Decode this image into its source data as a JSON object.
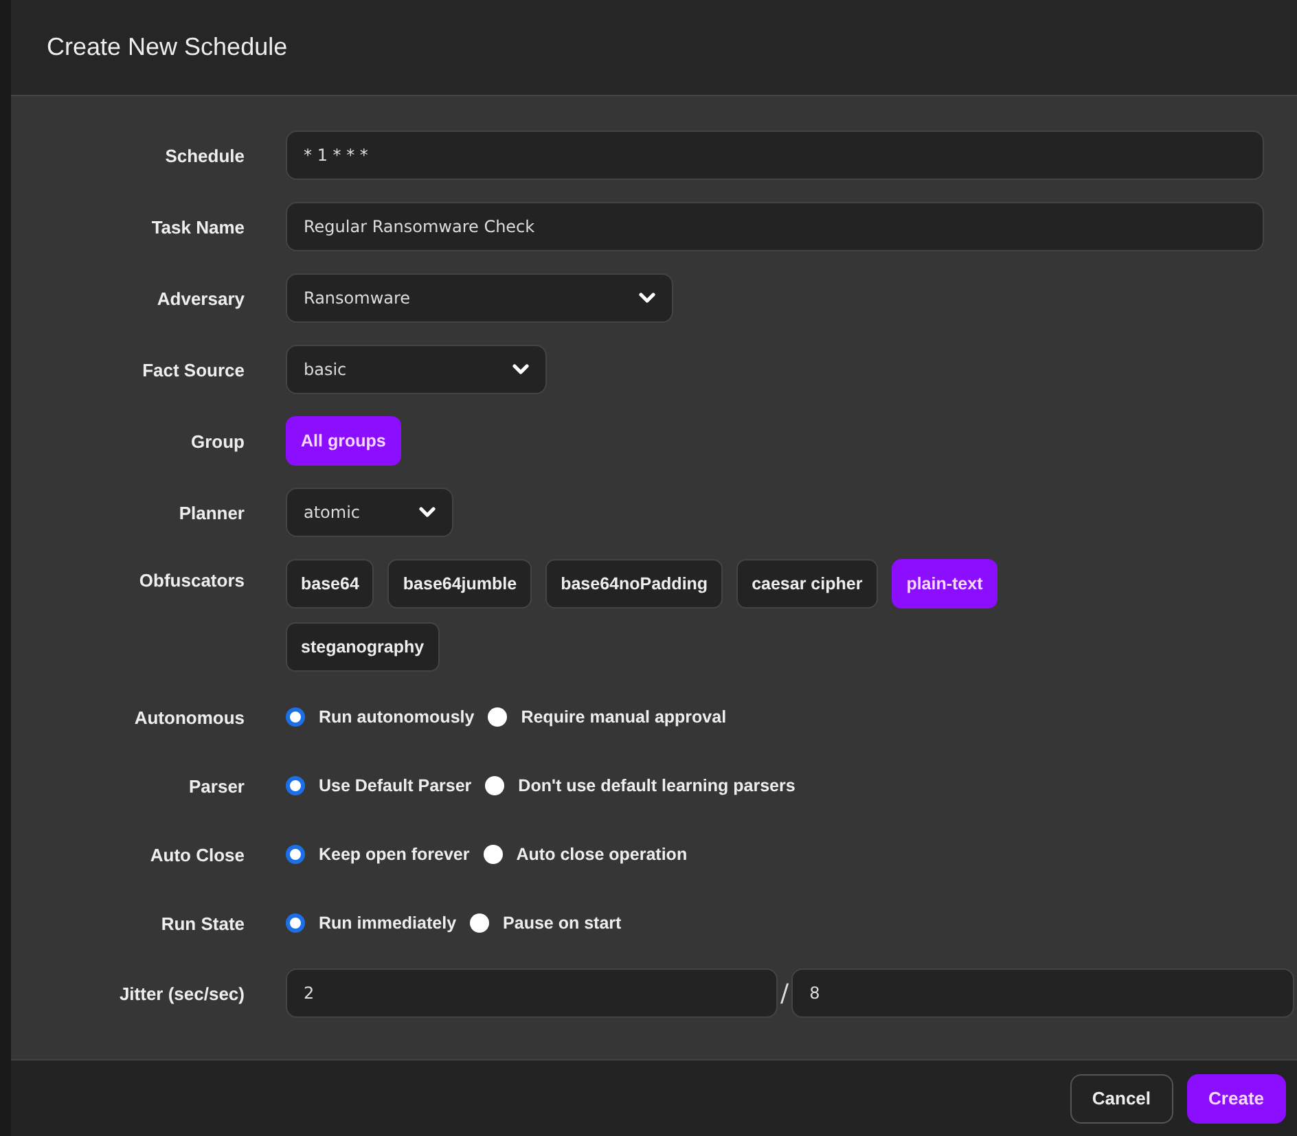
{
  "dialog": {
    "title": "Create New Schedule"
  },
  "fields": [
    {
      "kind": "text",
      "label": "Schedule",
      "value": "* 1 * * *"
    },
    {
      "kind": "text",
      "label": "Task Name",
      "value": "Regular Ransomware Check"
    },
    {
      "kind": "select",
      "label": "Adversary",
      "value": "Ransomware"
    },
    {
      "kind": "select",
      "label": "Fact Source",
      "value": "basic"
    },
    {
      "kind": "chips",
      "label": "Group",
      "options": [
        {
          "label": "All groups",
          "selected": true
        }
      ]
    },
    {
      "kind": "select",
      "label": "Planner",
      "value": "atomic"
    },
    {
      "kind": "chips",
      "label": "Obfuscators",
      "options": [
        {
          "label": "base64",
          "selected": false
        },
        {
          "label": "base64jumble",
          "selected": false
        },
        {
          "label": "base64noPadding",
          "selected": false
        },
        {
          "label": "caesar cipher",
          "selected": false
        },
        {
          "label": "plain-text",
          "selected": true
        },
        {
          "label": "steganography",
          "selected": false
        }
      ]
    },
    {
      "kind": "radio",
      "label": "Autonomous",
      "options": [
        {
          "label": "Run autonomously",
          "selected": true
        },
        {
          "label": "Require manual approval",
          "selected": false
        }
      ]
    },
    {
      "kind": "radio",
      "label": "Parser",
      "options": [
        {
          "label": "Use Default Parser",
          "selected": true
        },
        {
          "label": "Don't use default learning parsers",
          "selected": false
        }
      ]
    },
    {
      "kind": "radio",
      "label": "Auto Close",
      "options": [
        {
          "label": "Keep open forever",
          "selected": true
        },
        {
          "label": "Auto close operation",
          "selected": false
        }
      ]
    },
    {
      "kind": "radio",
      "label": "Run State",
      "options": [
        {
          "label": "Run immediately",
          "selected": true
        },
        {
          "label": "Pause on start",
          "selected": false
        }
      ]
    },
    {
      "kind": "range",
      "label": "Jitter (sec/sec)",
      "min": "2",
      "separator": "/",
      "max": "8"
    }
  ],
  "buttons": [
    {
      "label": "Cancel",
      "kind": "secondary"
    },
    {
      "label": "Create",
      "kind": "primary"
    }
  ]
}
